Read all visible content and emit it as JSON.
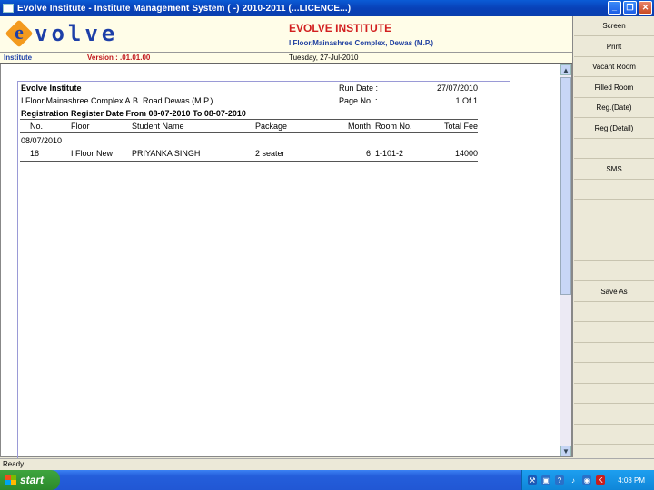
{
  "window": {
    "title": "Evolve Institute - Institute Management System ( -) 2010-2011 (...LICENCE...)"
  },
  "header": {
    "logo_text": "volve",
    "logo_letter": "e",
    "institute_name": "EVOLVE INSTITUTE",
    "address": "I Floor,Mainashree Complex, Dewas (M.P.)"
  },
  "infobar": {
    "module": "Institute",
    "version": "Version : .01.01.00",
    "date": "Tuesday, 27-Jul-2010"
  },
  "report": {
    "org_name": "Evolve Institute",
    "org_address": "I Floor,Mainashree Complex A.B. Road Dewas (M.P.)",
    "title": "Registration Register Date From 08-07-2010 To 08-07-2010",
    "run_date_label": "Run Date :",
    "run_date_value": "27/07/2010",
    "page_no_label": "Page No. :",
    "page_no_value": "1 Of 1",
    "columns": {
      "no": "No.",
      "floor": "Floor",
      "student": "Student Name",
      "package": "Package",
      "month": "Month",
      "room": "Room No.",
      "fee": "Total Fee"
    },
    "group_date": "08/07/2010",
    "rows": [
      {
        "no": "18",
        "floor": "I Floor New",
        "student": "PRIYANKA SINGH",
        "package": "2 seater",
        "month": "6",
        "room": "1-101-2",
        "fee": "14000"
      }
    ]
  },
  "panel": {
    "buttons": [
      "Screen",
      "Print",
      "Vacant Room",
      "Filled Room",
      "Reg.(Date)",
      "Reg.(Detail)",
      "",
      "SMS",
      "",
      "",
      "",
      "",
      "",
      "Save As",
      "",
      "",
      "",
      "",
      "",
      "",
      ""
    ]
  },
  "status": {
    "text": "Ready"
  },
  "taskbar": {
    "start_label": "start",
    "clock": "4:08 PM"
  }
}
